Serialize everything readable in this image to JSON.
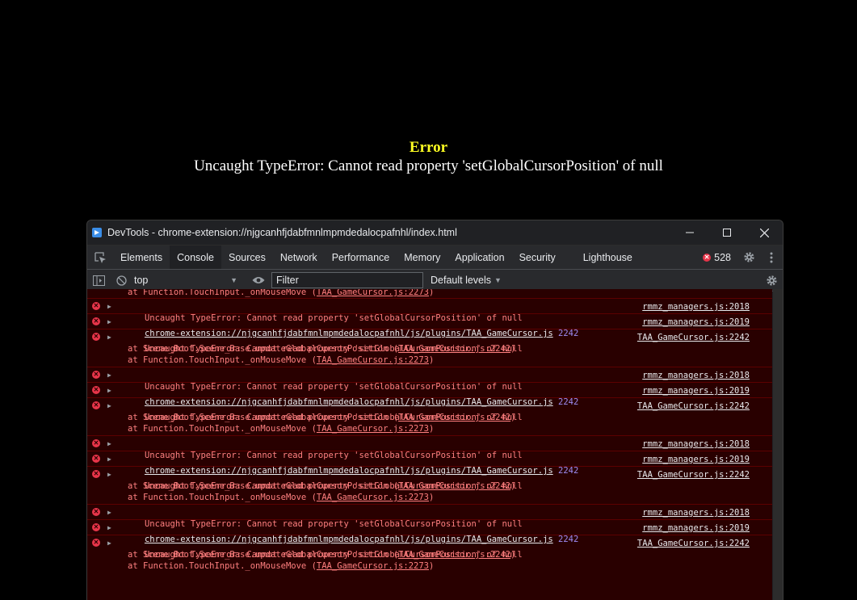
{
  "page_error": {
    "title": "Error",
    "message": "Uncaught TypeError: Cannot read property 'setGlobalCursorPosition' of null"
  },
  "devtools": {
    "window_title": "DevTools - chrome-extension://njgcanhfjdabfmnlmpmdedalocpafnhl/index.html",
    "tabs": [
      {
        "label": "Elements"
      },
      {
        "label": "Console"
      },
      {
        "label": "Sources"
      },
      {
        "label": "Network"
      },
      {
        "label": "Performance"
      },
      {
        "label": "Memory"
      },
      {
        "label": "Application"
      },
      {
        "label": "Security"
      },
      {
        "label": "Lighthouse"
      }
    ],
    "active_tab": "Console",
    "error_count": "528",
    "toolbar": {
      "context": "top",
      "filter_placeholder": "Filter",
      "levels": "Default levels"
    },
    "console": {
      "partial_top": {
        "prefix": "at Function.TouchInput._onMouseMove (",
        "link": "TAA_GameCursor.js:2273",
        "suffix": ")"
      },
      "groups": [
        {
          "e1": {
            "text": "Uncaught TypeError: Cannot read property 'setGlobalCursorPosition' of null",
            "source": "rmmz_managers.js:2018"
          },
          "e2": {
            "url": "chrome-extension://njgcanhfjdabfmnlmpmdedalocpafnhl/js/plugins/TAA_GameCursor.js",
            "line": "2242",
            "source": "rmmz_managers.js:2019"
          },
          "e3": {
            "text": "Uncaught TypeError: Cannot read property 'setGlobalCursorPosition' of null",
            "source": "TAA_GameCursor.js:2242",
            "s1_prefix": "at Scene_Boot.Scene_Base.updateGlobalCursorPosition (",
            "s1_link": "TAA_GameCursor.js:2242",
            "s2_prefix": "at Function.TouchInput._onMouseMove (",
            "s2_link": "TAA_GameCursor.js:2273",
            "close": ")"
          }
        },
        {
          "e1": {
            "text": "Uncaught TypeError: Cannot read property 'setGlobalCursorPosition' of null",
            "source": "rmmz_managers.js:2018"
          },
          "e2": {
            "url": "chrome-extension://njgcanhfjdabfmnlmpmdedalocpafnhl/js/plugins/TAA_GameCursor.js",
            "line": "2242",
            "source": "rmmz_managers.js:2019"
          },
          "e3": {
            "text": "Uncaught TypeError: Cannot read property 'setGlobalCursorPosition' of null",
            "source": "TAA_GameCursor.js:2242",
            "s1_prefix": "at Scene_Boot.Scene_Base.updateGlobalCursorPosition (",
            "s1_link": "TAA_GameCursor.js:2242",
            "s2_prefix": "at Function.TouchInput._onMouseMove (",
            "s2_link": "TAA_GameCursor.js:2273",
            "close": ")"
          }
        },
        {
          "e1": {
            "text": "Uncaught TypeError: Cannot read property 'setGlobalCursorPosition' of null",
            "source": "rmmz_managers.js:2018"
          },
          "e2": {
            "url": "chrome-extension://njgcanhfjdabfmnlmpmdedalocpafnhl/js/plugins/TAA_GameCursor.js",
            "line": "2242",
            "source": "rmmz_managers.js:2019"
          },
          "e3": {
            "text": "Uncaught TypeError: Cannot read property 'setGlobalCursorPosition' of null",
            "source": "TAA_GameCursor.js:2242",
            "s1_prefix": "at Scene_Boot.Scene_Base.updateGlobalCursorPosition (",
            "s1_link": "TAA_GameCursor.js:2242",
            "s2_prefix": "at Function.TouchInput._onMouseMove (",
            "s2_link": "TAA_GameCursor.js:2273",
            "close": ")"
          }
        },
        {
          "e1": {
            "text": "Uncaught TypeError: Cannot read property 'setGlobalCursorPosition' of null",
            "source": "rmmz_managers.js:2018"
          },
          "e2": {
            "url": "chrome-extension://njgcanhfjdabfmnlmpmdedalocpafnhl/js/plugins/TAA_GameCursor.js",
            "line": "2242",
            "source": "rmmz_managers.js:2019"
          },
          "e3": {
            "text": "Uncaught TypeError: Cannot read property 'setGlobalCursorPosition' of null",
            "source": "TAA_GameCursor.js:2242",
            "s1_prefix": "at Scene_Boot.Scene_Base.updateGlobalCursorPosition (",
            "s1_link": "TAA_GameCursor.js:2242",
            "s2_prefix": "at Function.TouchInput._onMouseMove (",
            "s2_link": "TAA_GameCursor.js:2273",
            "close": ")"
          }
        }
      ]
    },
    "colors": {
      "error_bg": "#290000",
      "error_text": "#ff8080",
      "line_number": "#9d8cf4",
      "error_icon": "#e8354a",
      "page_error_title": "#ffff22"
    },
    "icons": [
      "devtools-app-icon",
      "minimize-icon",
      "maximize-icon",
      "close-icon",
      "inspect-element-icon",
      "settings-icon",
      "more-vertical-icon",
      "sidebar-toggle-icon",
      "clear-console-icon",
      "eye-icon",
      "error-icon",
      "expand-triangle-icon"
    ]
  }
}
